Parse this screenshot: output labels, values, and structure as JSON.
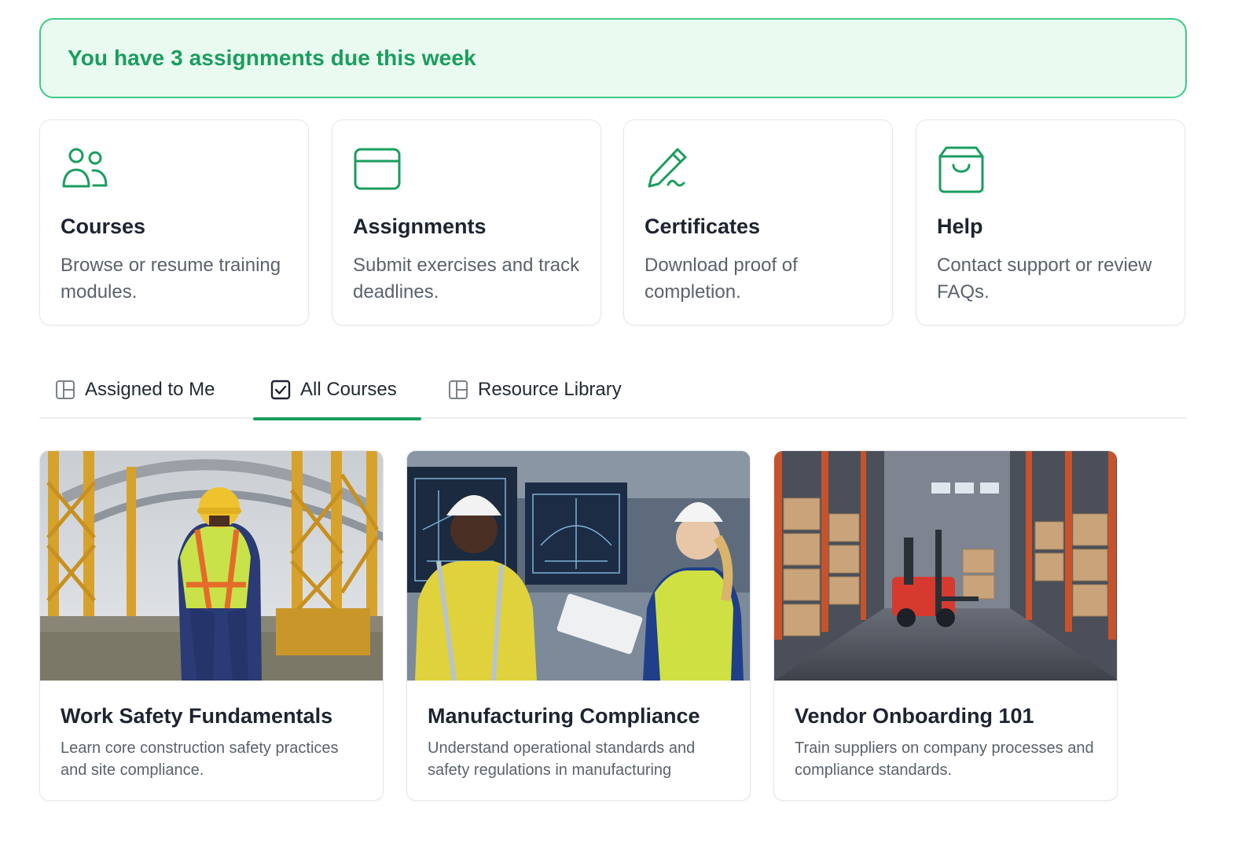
{
  "banner": {
    "text": "You have 3 assignments due this week"
  },
  "quick_links": [
    {
      "icon": "users-icon",
      "title": "Courses",
      "description": "Browse or resume training modules."
    },
    {
      "icon": "window-icon",
      "title": "Assignments",
      "description": "Submit exercises and track deadlines."
    },
    {
      "icon": "pen-icon",
      "title": "Certificates",
      "description": "Download proof of completion."
    },
    {
      "icon": "bag-icon",
      "title": "Help",
      "description": "Contact support or review FAQs."
    }
  ],
  "tabs": [
    {
      "icon": "layout-icon",
      "label": "Assigned to Me",
      "active": false
    },
    {
      "icon": "checkbox-icon",
      "label": "All Courses",
      "active": true
    },
    {
      "icon": "layout-icon",
      "label": "Resource Library",
      "active": false
    }
  ],
  "courses": [
    {
      "image": "construction-worker-image",
      "title": "Work Safety Fundamentals",
      "description": "Learn core construction safety practices and site compliance."
    },
    {
      "image": "factory-engineers-image",
      "title": "Manufacturing Compliance",
      "description": "Understand operational standards and safety regulations in manufacturing"
    },
    {
      "image": "warehouse-forklift-image",
      "title": "Vendor Onboarding 101",
      "description": "Train suppliers on company processes and compliance standards."
    }
  ],
  "colors": {
    "accent": "#1a9d5e",
    "banner_bg": "#e9fbf1",
    "banner_border": "#3ccb86",
    "icon": "#1a9d5e"
  }
}
